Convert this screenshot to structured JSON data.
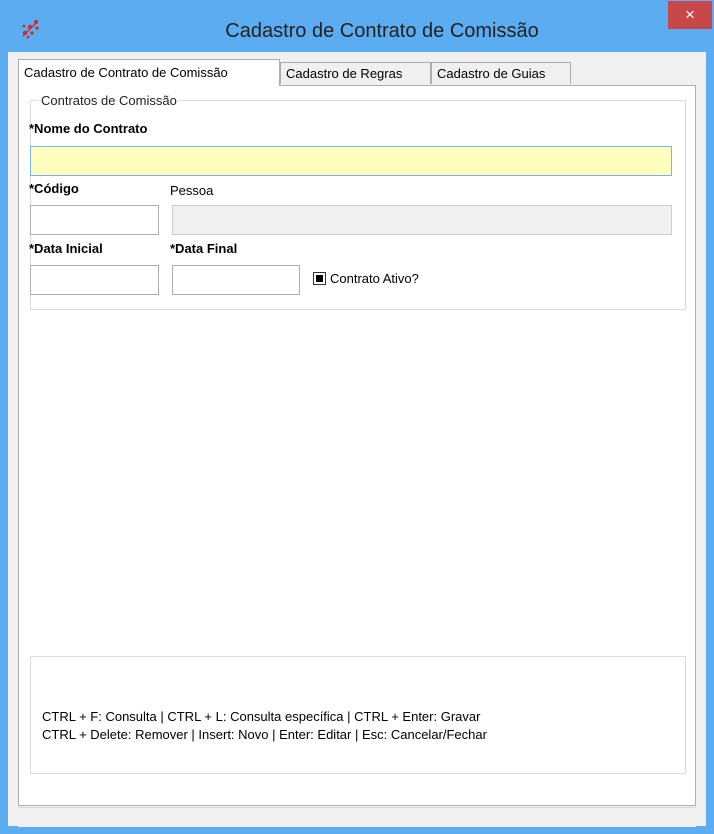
{
  "window": {
    "title": "Cadastro de Contrato de Comissão",
    "close_label": "×",
    "accent": "#5cacf2",
    "close_color": "#c8484a"
  },
  "tabs": [
    {
      "label": "Cadastro de Contrato de Comissão",
      "active": true
    },
    {
      "label": "Cadastro de Regras",
      "active": false
    },
    {
      "label": "Cadastro de Guias",
      "active": false
    }
  ],
  "group": {
    "legend": "Contratos de Comissão",
    "nome_label": "*Nome do Contrato",
    "nome_value": "",
    "codigo_label": "*Código",
    "codigo_value": "",
    "pessoa_label": "Pessoa",
    "pessoa_value": "",
    "data_inicial_label": "*Data Inicial",
    "data_inicial_value": "",
    "data_final_label": "*Data Final",
    "data_final_value": "",
    "ativo_label": "Contrato Ativo?",
    "ativo_checked": true
  },
  "hotkeys": {
    "line1": "CTRL + F: Consulta | CTRL + L: Consulta específica | CTRL + Enter: Gravar",
    "line2": "CTRL + Delete: Remover | Insert: Novo | Enter: Editar | Esc: Cancelar/Fechar"
  }
}
